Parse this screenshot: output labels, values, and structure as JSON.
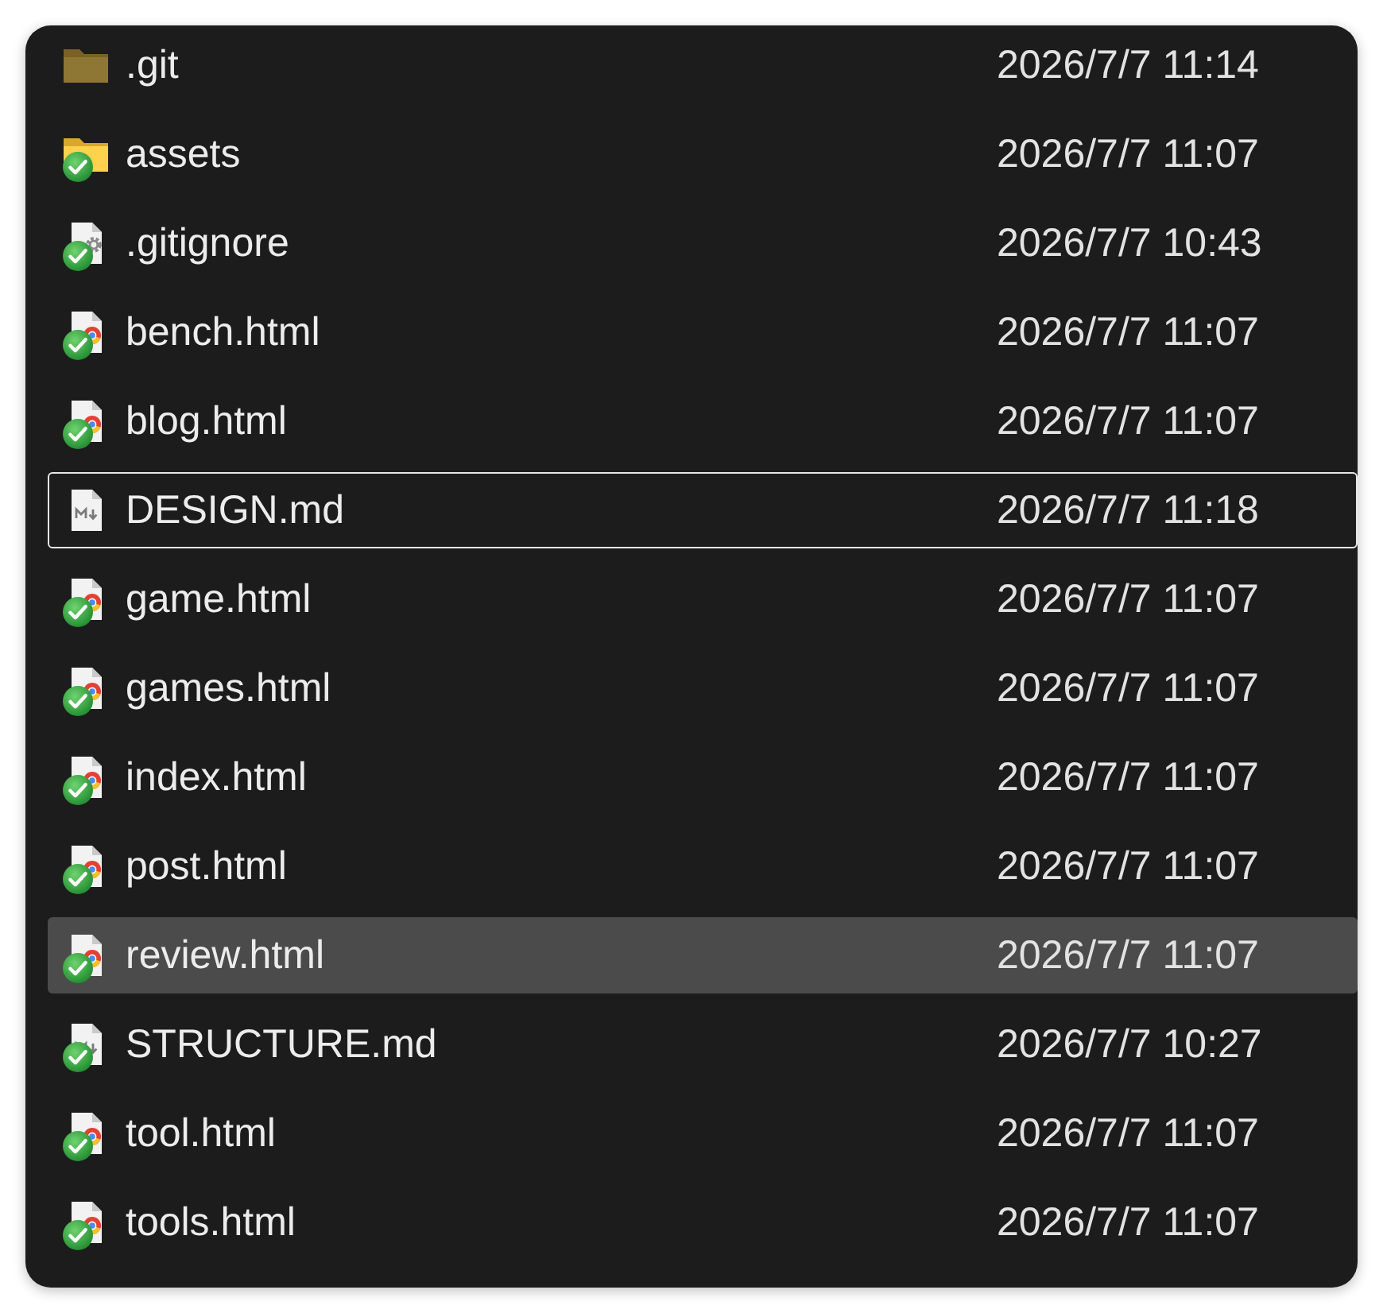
{
  "files": [
    {
      "name": ".git",
      "modified": "2026/7/7 11:14",
      "kind": "folder",
      "hidden": true,
      "synced": false,
      "selected": false,
      "focused": false
    },
    {
      "name": "assets",
      "modified": "2026/7/7 11:07",
      "kind": "folder",
      "hidden": false,
      "synced": true,
      "selected": false,
      "focused": false
    },
    {
      "name": ".gitignore",
      "modified": "2026/7/7 10:43",
      "kind": "settings-file",
      "hidden": false,
      "synced": true,
      "selected": false,
      "focused": false
    },
    {
      "name": "bench.html",
      "modified": "2026/7/7 11:07",
      "kind": "html-file",
      "hidden": false,
      "synced": true,
      "selected": false,
      "focused": false
    },
    {
      "name": "blog.html",
      "modified": "2026/7/7 11:07",
      "kind": "html-file",
      "hidden": false,
      "synced": true,
      "selected": false,
      "focused": false
    },
    {
      "name": "DESIGN.md",
      "modified": "2026/7/7 11:18",
      "kind": "markdown-file",
      "hidden": false,
      "synced": false,
      "selected": false,
      "focused": true
    },
    {
      "name": "game.html",
      "modified": "2026/7/7 11:07",
      "kind": "html-file",
      "hidden": false,
      "synced": true,
      "selected": false,
      "focused": false
    },
    {
      "name": "games.html",
      "modified": "2026/7/7 11:07",
      "kind": "html-file",
      "hidden": false,
      "synced": true,
      "selected": false,
      "focused": false
    },
    {
      "name": "index.html",
      "modified": "2026/7/7 11:07",
      "kind": "html-file",
      "hidden": false,
      "synced": true,
      "selected": false,
      "focused": false
    },
    {
      "name": "post.html",
      "modified": "2026/7/7 11:07",
      "kind": "html-file",
      "hidden": false,
      "synced": true,
      "selected": false,
      "focused": false
    },
    {
      "name": "review.html",
      "modified": "2026/7/7 11:07",
      "kind": "html-file",
      "hidden": false,
      "synced": true,
      "selected": true,
      "focused": false
    },
    {
      "name": "STRUCTURE.md",
      "modified": "2026/7/7 10:27",
      "kind": "markdown-file",
      "hidden": false,
      "synced": true,
      "selected": false,
      "focused": false
    },
    {
      "name": "tool.html",
      "modified": "2026/7/7 11:07",
      "kind": "html-file",
      "hidden": false,
      "synced": true,
      "selected": false,
      "focused": false
    },
    {
      "name": "tools.html",
      "modified": "2026/7/7 11:07",
      "kind": "html-file",
      "hidden": false,
      "synced": true,
      "selected": false,
      "focused": false
    }
  ]
}
